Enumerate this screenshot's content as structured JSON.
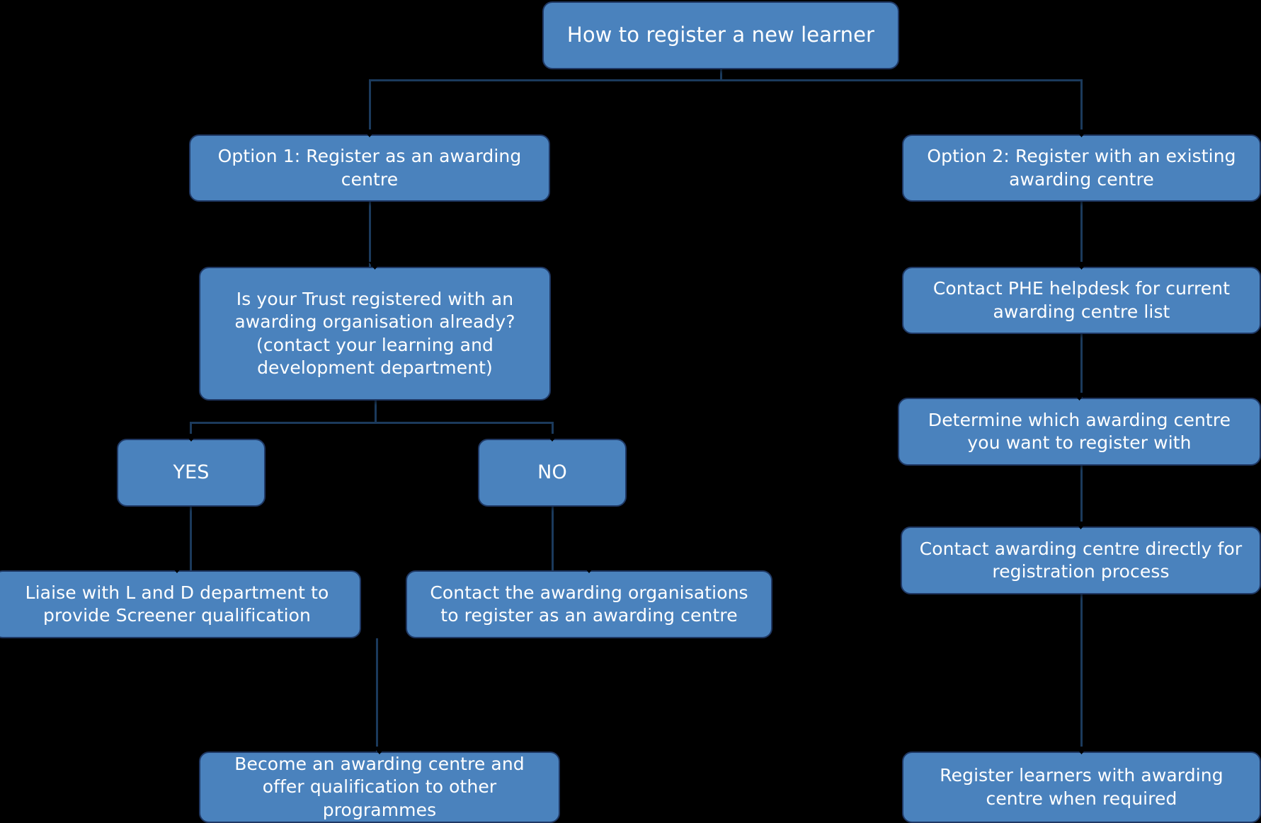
{
  "diagram": {
    "title": "How to register a new learner",
    "background_color": "#000000",
    "node_fill_color": "#4a82bd",
    "node_border_color": "#1f3864",
    "node_text_color": "#ffffff",
    "nodes": {
      "title": "How to register a new learner",
      "option1": "Option 1: Register as an awarding centre",
      "option2": "Option 2: Register with an existing awarding centre",
      "question": "Is your Trust  registered with an awarding organisation already? (contact your learning and development department)",
      "phe_helpdesk": "Contact PHE helpdesk for current awarding centre list",
      "yes": "YES",
      "no": "NO",
      "determine_centre": "Determine which awarding centre you want to register with",
      "liaise_ld": "Liaise with L and D department to provide Screener qualification",
      "contact_organisations": "Contact the awarding organisations to register as an awarding centre",
      "contact_centre_directly": "Contact awarding centre directly for registration process",
      "become_centre": "Become an awarding centre and offer qualification to other programmes",
      "register_learners": "Register learners with awarding centre when required"
    }
  },
  "chart_data": {
    "type": "table",
    "title": "How to register a new learner",
    "branches": [
      {
        "name": "Option 1: Register as an awarding centre",
        "steps": [
          "Is your Trust  registered with an awarding organisation already? (contact your learning and development department)",
          "YES -> Liaise with L and D department to provide Screener qualification",
          "NO -> Contact the awarding organisations to register as an awarding centre",
          "Become an awarding centre and offer qualification to other programmes"
        ]
      },
      {
        "name": "Option 2: Register with an existing awarding centre",
        "steps": [
          "Contact PHE helpdesk for current awarding centre list",
          "Determine which awarding centre you want to register with",
          "Contact awarding centre directly for registration process",
          "Register learners with awarding centre when required"
        ]
      }
    ]
  }
}
